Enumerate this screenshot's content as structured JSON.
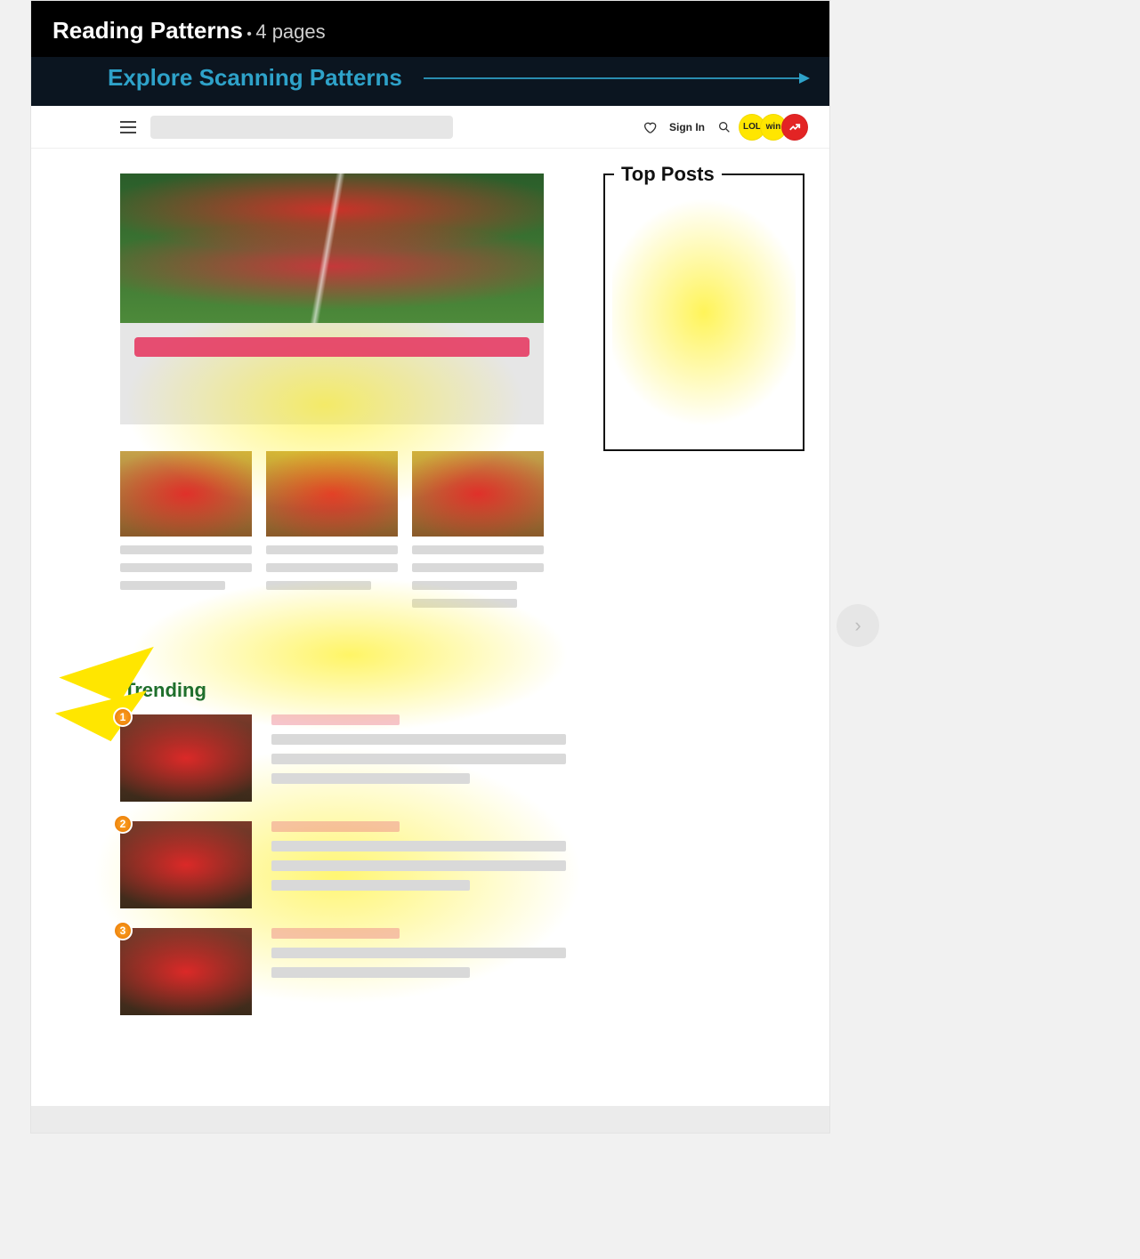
{
  "header": {
    "title": "Reading Patterns",
    "separator": "•",
    "pages_label": "4 pages",
    "explore_label": "Explore Scanning Patterns"
  },
  "topbar": {
    "sign_in": "Sign In",
    "badges": [
      "LOL",
      "win",
      "↗"
    ]
  },
  "top_posts": {
    "label": "Top Posts"
  },
  "trending": {
    "heading": "Trending",
    "items": [
      {
        "rank": "1"
      },
      {
        "rank": "2"
      },
      {
        "rank": "3"
      }
    ]
  },
  "nav": {
    "next_glyph": "›"
  }
}
